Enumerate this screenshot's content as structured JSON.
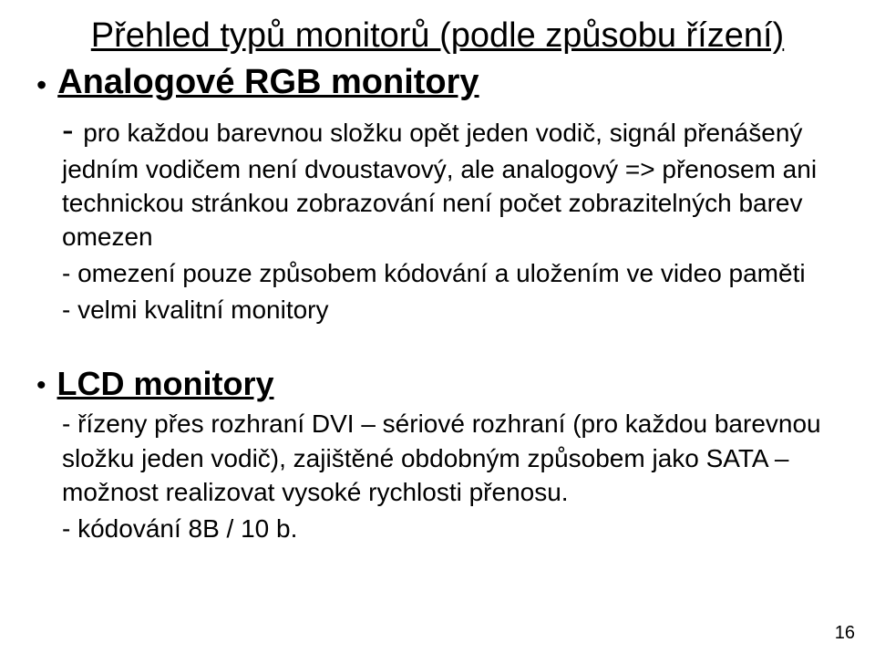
{
  "title": "Přehled typů monitorů (podle způsobu řízení)",
  "section1": {
    "heading": "Analogové RGB monitory",
    "lead": "pro každou barevnou složku opět jeden vodič, signál přenášený jedním vodičem není dvoustavový, ale analogový => přenosem ani technickou  stránkou zobrazování není počet zobrazitelných barev omezen",
    "line_limited": "- omezení pouze způsobem kódování a uložením ve video paměti",
    "line_quality": "- velmi kvalitní monitory"
  },
  "section2": {
    "heading": "LCD monitory",
    "lead": "- řízeny přes rozhraní DVI – sériové rozhraní (pro každou barevnou složku jeden vodič), zajištěné obdobným způsobem jako SATA – možnost realizovat vysoké rychlosti přenosu.",
    "line_coding": "- kódování 8B / 10 b."
  },
  "page_number": "16"
}
